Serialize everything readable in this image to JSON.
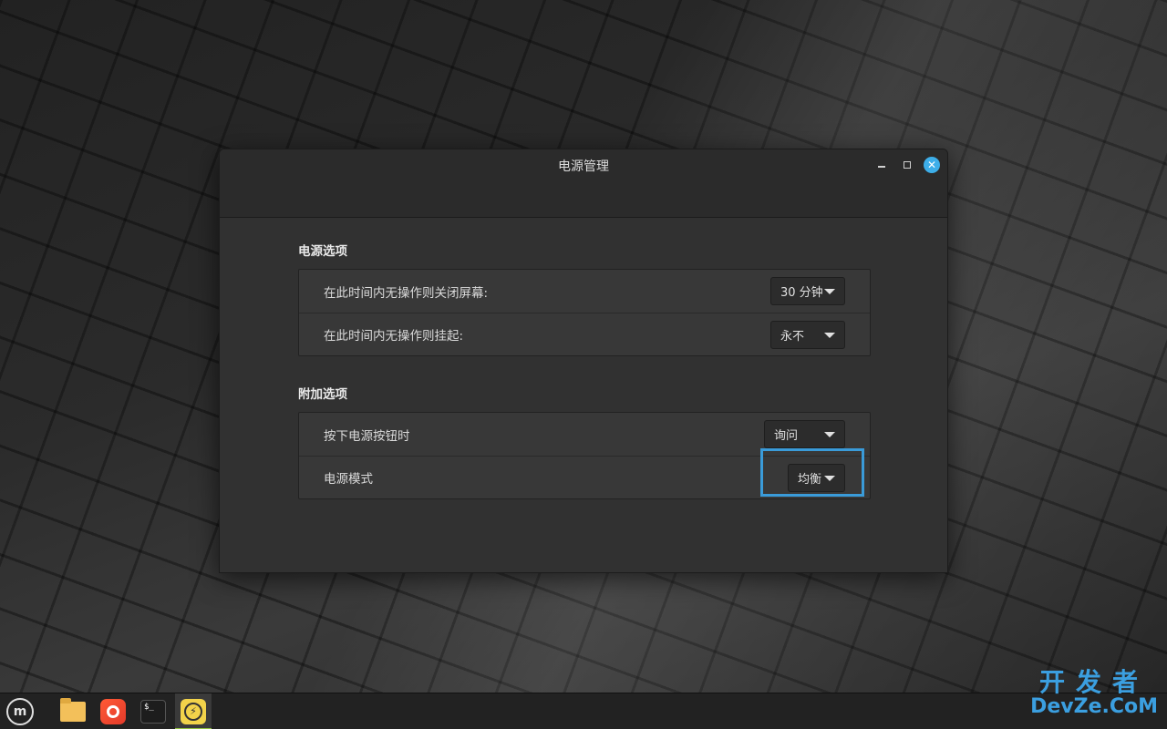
{
  "window": {
    "title": "电源管理"
  },
  "sections": {
    "power": {
      "title": "电源选项",
      "rows": [
        {
          "label": "在此时间内无操作则关闭屏幕:",
          "value": "30 分钟"
        },
        {
          "label": "在此时间内无操作则挂起:",
          "value": "永不"
        }
      ]
    },
    "extra": {
      "title": "附加选项",
      "rows": [
        {
          "label": "按下电源按钮时",
          "value": "询问"
        },
        {
          "label": "电源模式",
          "value": "均衡"
        }
      ]
    }
  },
  "taskbar": {
    "menu_glyph": "m",
    "terminal_glyph": "$_",
    "power_glyph": "⚡"
  },
  "watermark": {
    "line1": "开发者",
    "line2": "DevZe.CoM"
  },
  "colors": {
    "accent": "#3daee9",
    "highlight": "#3a9bd9",
    "window_bg": "#313131",
    "frame_bg": "#383838"
  }
}
